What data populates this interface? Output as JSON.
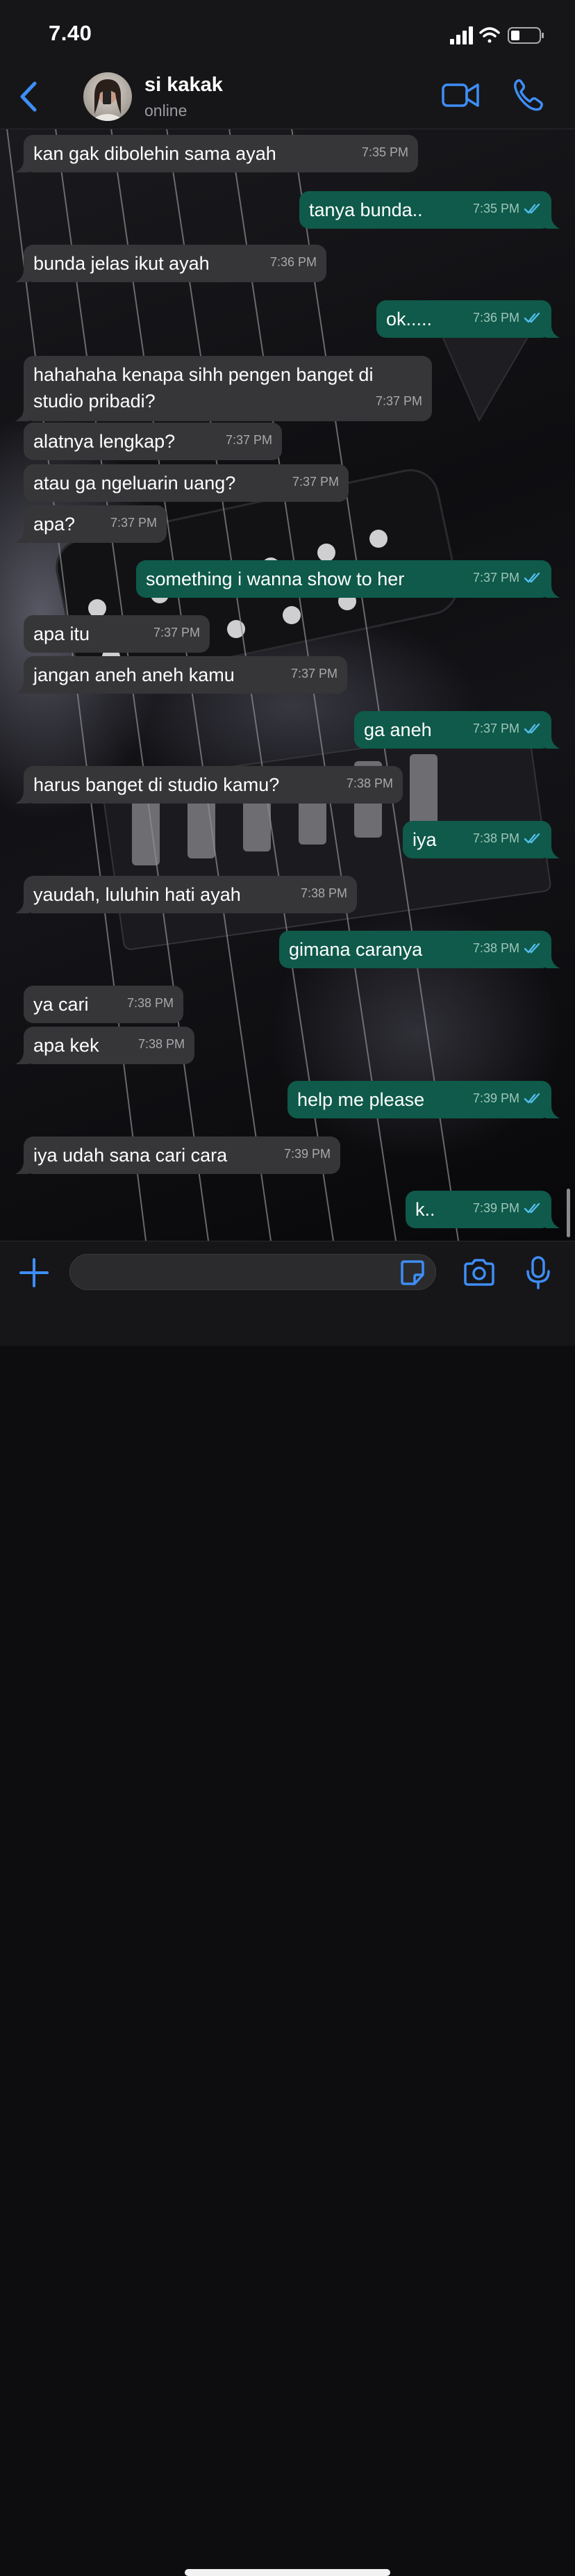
{
  "status_bar": {
    "time": "7.40"
  },
  "header": {
    "contact_name": "si kakak",
    "contact_status": "online",
    "back_icon": "chevron-left-icon",
    "video_icon": "video-camera-icon",
    "call_icon": "phone-icon"
  },
  "colors": {
    "accent": "#3e8ef7",
    "incoming_bubble": "#363639",
    "outgoing_bubble": "#0f5a4a",
    "read_tick": "#53bdeb"
  },
  "messages": [
    {
      "dir": "in",
      "text": "kan gak dibolehin sama ayah",
      "time": "7:35 PM"
    },
    {
      "dir": "out",
      "text": "tanya bunda..",
      "time": "7:35 PM"
    },
    {
      "dir": "in",
      "text": "bunda jelas ikut ayah",
      "time": "7:36 PM"
    },
    {
      "dir": "out",
      "text": "ok.....",
      "time": "7:36 PM"
    },
    {
      "dir": "in",
      "text": "hahahaha kenapa sihh pengen banget di studio pribadi?",
      "time": "7:37 PM"
    },
    {
      "dir": "in",
      "text": "alatnya lengkap?",
      "time": "7:37 PM"
    },
    {
      "dir": "in",
      "text": "atau ga ngeluarin uang?",
      "time": "7:37 PM"
    },
    {
      "dir": "in",
      "text": "apa?",
      "time": "7:37 PM"
    },
    {
      "dir": "out",
      "text": "something i wanna show to her",
      "time": "7:37 PM"
    },
    {
      "dir": "in",
      "text": "apa itu",
      "time": "7:37 PM"
    },
    {
      "dir": "in",
      "text": "jangan aneh aneh kamu",
      "time": "7:37 PM"
    },
    {
      "dir": "out",
      "text": "ga aneh",
      "time": "7:37 PM"
    },
    {
      "dir": "in",
      "text": "harus banget di studio kamu?",
      "time": "7:38 PM"
    },
    {
      "dir": "out",
      "text": "iya",
      "time": "7:38 PM"
    },
    {
      "dir": "in",
      "text": "yaudah, luluhin hati ayah",
      "time": "7:38 PM"
    },
    {
      "dir": "out",
      "text": "gimana caranya",
      "time": "7:38 PM"
    },
    {
      "dir": "in",
      "text": "ya cari",
      "time": "7:38 PM"
    },
    {
      "dir": "in",
      "text": "apa kek",
      "time": "7:38 PM"
    },
    {
      "dir": "out",
      "text": "help me please",
      "time": "7:39 PM"
    },
    {
      "dir": "in",
      "text": "iya udah sana cari cara",
      "time": "7:39 PM"
    },
    {
      "dir": "out",
      "text": "k..",
      "time": "7:39 PM"
    }
  ],
  "input_bar": {
    "placeholder": "",
    "value": ""
  }
}
